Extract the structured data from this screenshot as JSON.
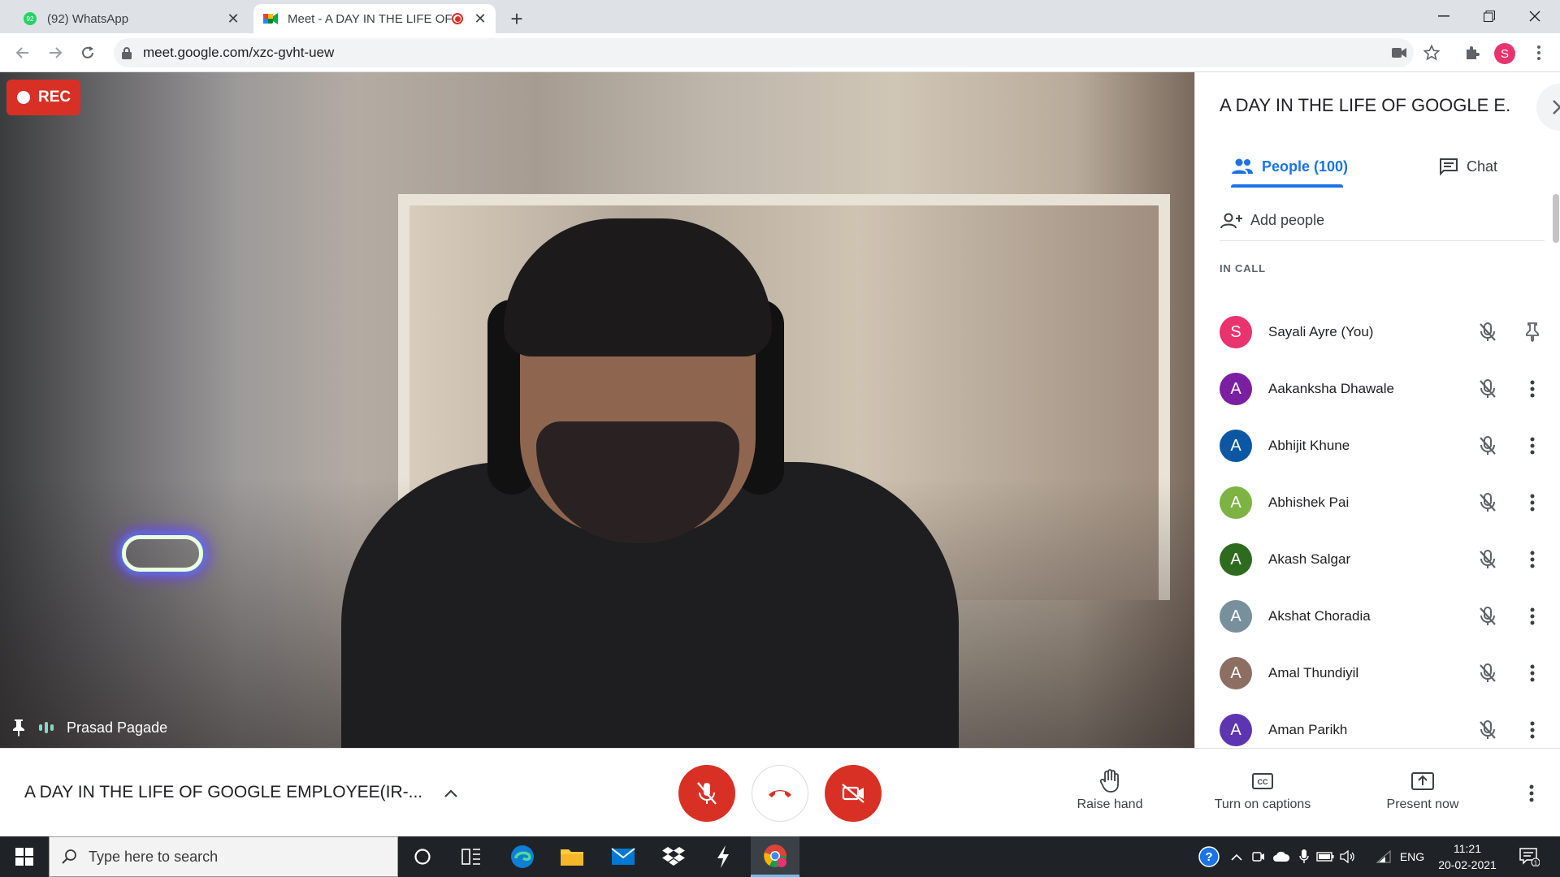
{
  "browser": {
    "tabs": [
      {
        "title": "(92) WhatsApp",
        "badge": "92",
        "active": false
      },
      {
        "title": "Meet - A DAY IN THE LIFE OF",
        "active": true
      }
    ],
    "url": "meet.google.com/xzc-gvht-uew",
    "profile_initial": "S"
  },
  "video": {
    "rec_label": "REC",
    "speaker_name": "Prasad Pagade"
  },
  "panel": {
    "title": "A DAY IN THE LIFE OF GOOGLE E...",
    "people_tab": "People (100)",
    "chat_tab": "Chat",
    "add_people": "Add people",
    "section_label": "IN CALL",
    "participants": [
      {
        "initial": "S",
        "name": "Sayali Ayre (You)",
        "color": "#e8336e",
        "action": "pin"
      },
      {
        "initial": "A",
        "name": "Aakanksha Dhawale",
        "color": "#7b1fa2",
        "action": "more"
      },
      {
        "initial": "A",
        "name": "Abhijit Khune",
        "color": "#0b57a4",
        "action": "more"
      },
      {
        "initial": "A",
        "name": "Abhishek Pai",
        "color": "#7cb342",
        "action": "more"
      },
      {
        "initial": "A",
        "name": "Akash Salgar",
        "color": "#2e6b1f",
        "action": "more"
      },
      {
        "initial": "A",
        "name": "Akshat Choradia",
        "color": "#78909c",
        "action": "more"
      },
      {
        "initial": "A",
        "name": "Amal Thundiyil",
        "color": "#8d6e63",
        "action": "more"
      },
      {
        "initial": "A",
        "name": "Aman Parikh",
        "color": "#5e35b1",
        "action": "more"
      }
    ]
  },
  "bottom_bar": {
    "meeting_title": "A DAY IN THE LIFE OF GOOGLE EMPLOYEE(IR-...",
    "raise_hand": "Raise hand",
    "captions": "Turn on captions",
    "present": "Present now"
  },
  "taskbar": {
    "search_placeholder": "Type here to search",
    "language": "ENG",
    "time": "11:21",
    "date": "20-02-2021",
    "notification_count": "1"
  }
}
